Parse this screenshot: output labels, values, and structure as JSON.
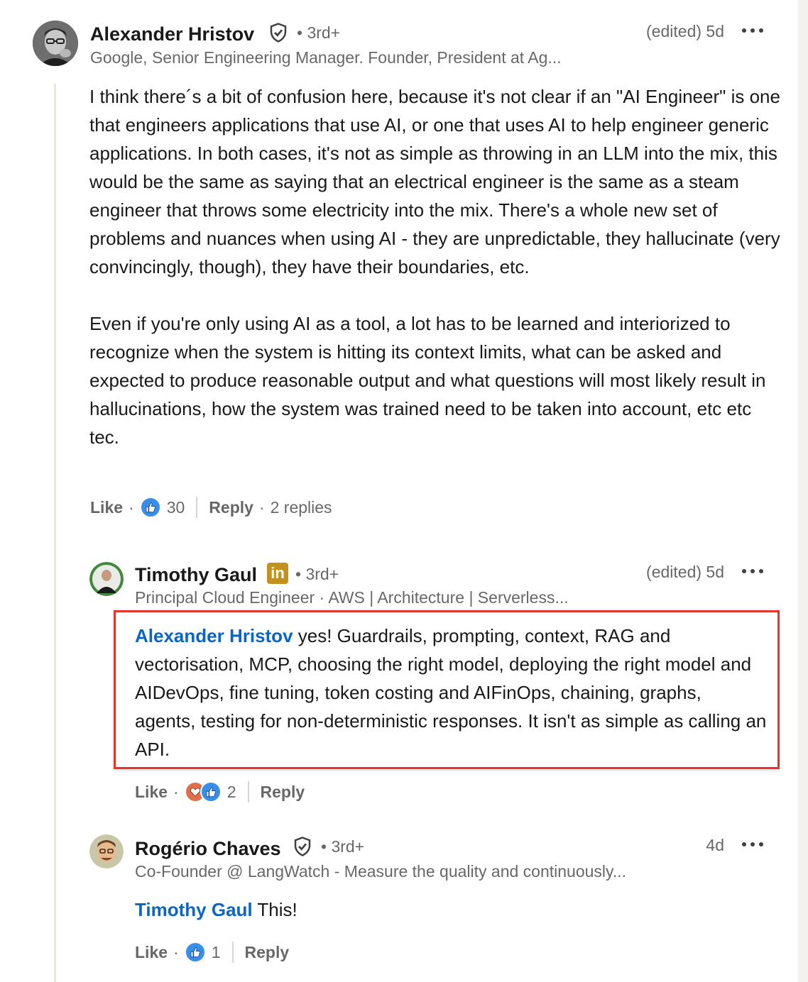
{
  "comments": [
    {
      "author": "Alexander Hristov",
      "verified_icon": "shield-check-icon",
      "degree": "• 3rd+",
      "time": "(edited)  5d",
      "headline": "Google, Senior Engineering Manager. Founder, President at Ag...",
      "paragraphs": [
        "I think there´s a bit of confusion here, because it's not clear if an \"AI Engineer\" is one that engineers applications that use AI, or one that uses AI to help engineer generic applications. In both cases, it's not as simple as throwing in an LLM into the mix, this would be the same as saying that an electrical engineer is the same as a steam engineer that throws some electricity into the mix. There's a whole new set of problems and nuances when using AI - they are unpredictable, they hallucinate (very convincingly, though), they have their boundaries, etc.",
        "Even if you're only using AI as a tool, a lot has to be learned and interiorized to recognize when the system is hitting its context limits, what can be asked and expected to produce reasonable output and what questions will most likely result in hallucinations, how the system was trained need to be taken into account, etc etc tec."
      ],
      "like_label": "Like",
      "reaction_count": "30",
      "reply_label": "Reply",
      "replies_label": "2 replies"
    },
    {
      "author": "Timothy Gaul",
      "badge_icon": "linkedin-in-icon",
      "badge_text": "in",
      "degree": "• 3rd+",
      "time": "(edited)  5d",
      "headline": "Principal Cloud Engineer · AWS | Architecture | Serverless...",
      "mention": "Alexander Hristov",
      "text": " yes! Guardrails, prompting, context, RAG and vectorisation, MCP, choosing the right model, deploying the right model and AIDevOps, fine tuning, token costing and AIFinOps, chaining, graphs, agents, testing for non-deterministic responses. It isn't as simple as calling an API.",
      "like_label": "Like",
      "reaction_count": "2",
      "reply_label": "Reply"
    },
    {
      "author": "Rogério Chaves",
      "verified_icon": "shield-check-icon",
      "degree": "• 3rd+",
      "time": "4d",
      "headline": "Co-Founder @ LangWatch - Measure the quality and continuously...",
      "mention": "Timothy Gaul",
      "text": " This!",
      "like_label": "Like",
      "reaction_count": "1",
      "reply_label": "Reply"
    }
  ],
  "colors": {
    "mention_blue": "#0a66c2",
    "highlight_red": "#e8322a",
    "like_blue": "#378fe9",
    "love_orange": "#df704d"
  }
}
